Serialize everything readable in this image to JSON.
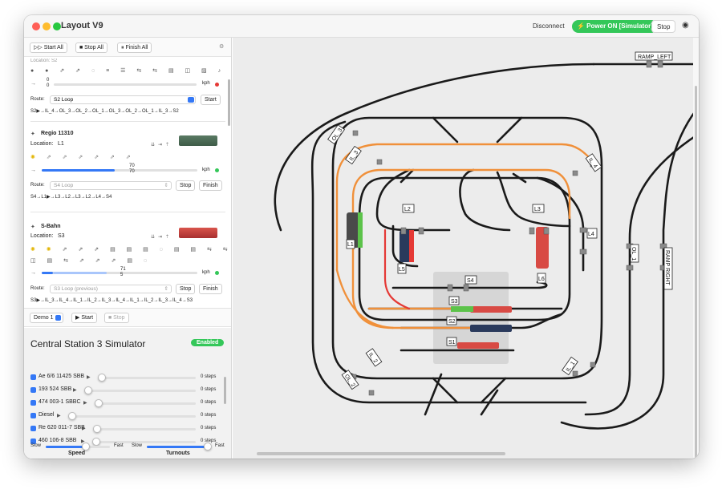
{
  "window": {
    "title": "Layout V9"
  },
  "titlebar": {
    "disconnect": "Disconnect",
    "power": "⚡ Power ON [Simulator]",
    "stop": "Stop",
    "eye_icon": "eye-icon"
  },
  "toolbar": {
    "start_all": "▷▷ Start All",
    "stop_all": "■ Stop All",
    "finish_all": "⏸ Finish All",
    "settings_icon": "gear-icon"
  },
  "loco1": {
    "location_partial": "Location: S2",
    "speed_a": "0",
    "speed_b": "0",
    "unit": "kph",
    "route_label": "Route:",
    "route": "S2 Loop",
    "route_btn": "Start",
    "route_path": "S2▶→IL_4→OL_3→OL_2→OL_1→OL_3→OL_2→OL_1→IL_3→S2",
    "status_color": "#e53935"
  },
  "loco2": {
    "name": "Regio 11310",
    "location_label": "Location:",
    "location": "L1",
    "speed_a": "70",
    "speed_b": "70",
    "speed_fraction": 0.47,
    "unit": "kph",
    "route_label": "Route:",
    "route": "S4 Loop",
    "stop": "Stop",
    "finish": "Finish",
    "route_path": "S4→L1▶→L3→L2→L3→L2→L4→S4",
    "status_color": "#34c759"
  },
  "loco3": {
    "name": "S-Bahn",
    "location_label": "Location:",
    "location": "S3",
    "speed_a": "71",
    "speed_b": "5",
    "speed_fraction": 0.42,
    "unit": "kph",
    "route_label": "Route:",
    "route": "S3 Loop (previous)",
    "stop": "Stop",
    "finish": "Finish",
    "route_path": "S3▶→IL_3→IL_4→IL_1→IL_2→IL_3→IL_4→IL_1→IL_2→IL_3→IL_4→S3",
    "status_color": "#34c759"
  },
  "demo": {
    "select": "Demo 1",
    "start": "▶ Start",
    "stop": "■ Stop"
  },
  "simulator": {
    "title": "Central Station 3 Simulator",
    "status": "Enabled",
    "locos": [
      {
        "name": "Ae 6/6 11425 SBB",
        "steps": "0 steps"
      },
      {
        "name": "193 524 SBB",
        "steps": "0 steps"
      },
      {
        "name": "474 003-1 SBBC",
        "steps": "0 steps"
      },
      {
        "name": "Diesel",
        "steps": "0 steps"
      },
      {
        "name": "Re 620 011-7 SBB",
        "steps": "0 steps"
      },
      {
        "name": "460 106-8 SBB",
        "steps": "0 steps"
      }
    ],
    "speed_title": "Speed",
    "turnouts_title": "Turnouts",
    "slow": "Slow",
    "fast": "Fast",
    "speed_fraction": 0.62,
    "turnouts_fraction": 0.95
  },
  "layout": {
    "labels": [
      "RAMP_LEFT",
      "RAMP RIGHT",
      "OL_3",
      "OL_1",
      "OL_2",
      "IL_3",
      "IL_4",
      "IL_1",
      "IL_2",
      "L1",
      "L2",
      "L3",
      "L4",
      "L5",
      "L6",
      "S1",
      "S2",
      "S3",
      "S4"
    ],
    "colors": {
      "track": "#1a1a1a",
      "orange": "#f0903a",
      "red": "#e53935",
      "green": "#5cc34a"
    }
  }
}
